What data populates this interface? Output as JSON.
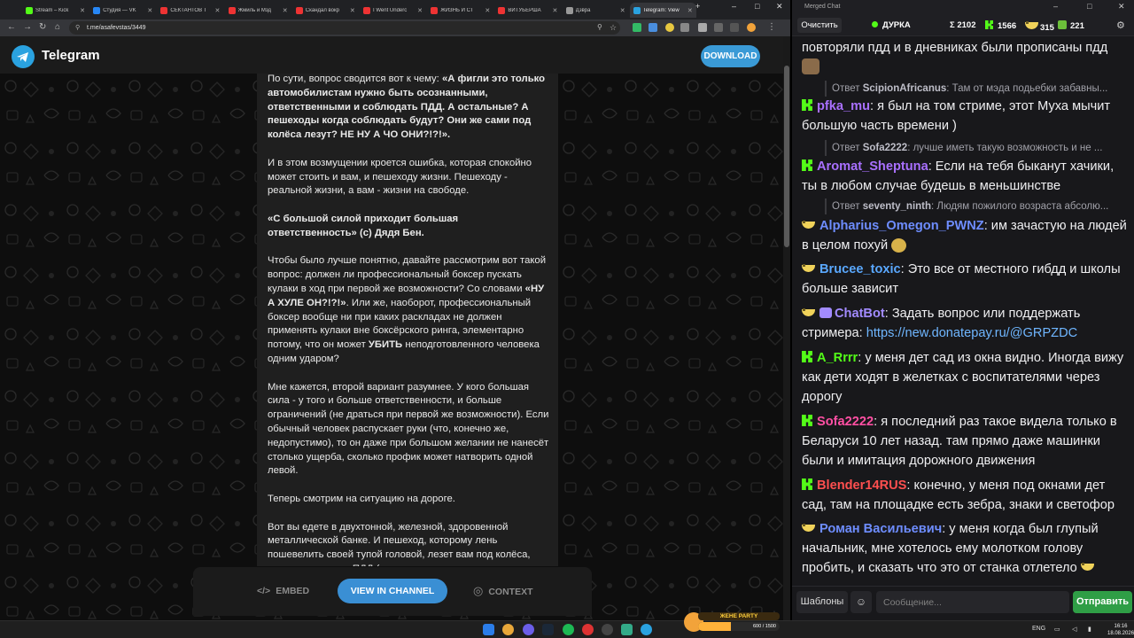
{
  "browser": {
    "tabs": [
      {
        "label": "Stream – Kick",
        "color": "#53fc18",
        "active": false
      },
      {
        "label": "Студия — VK",
        "color": "#2787f5",
        "active": false
      },
      {
        "label": "СЕКТАНТОВ Т",
        "color": "#e33",
        "active": false
      },
      {
        "label": "Жмиль и Мзд",
        "color": "#e33",
        "active": false
      },
      {
        "label": "Скандал вокр",
        "color": "#e33",
        "active": false
      },
      {
        "label": "I Went Underc",
        "color": "#e33",
        "active": false
      },
      {
        "label": "ЖИЗНЬ И СТ",
        "color": "#e33",
        "active": false
      },
      {
        "label": "ВИТУБЕРША",
        "color": "#e33",
        "active": false
      },
      {
        "label": "Дзвра",
        "color": "#999",
        "active": false
      },
      {
        "label": "Telegram: View",
        "color": "#2aa2e0",
        "active": true
      }
    ],
    "new_tab": "+",
    "window_controls": {
      "minimize": "–",
      "maximize": "□",
      "close": "✕"
    },
    "url": "t.me/asafevstas/3449"
  },
  "telegram": {
    "brand": "Telegram",
    "download_label": "DOWNLOAD",
    "post_paragraphs": [
      [
        "По сути, вопрос сводится вот к чему: ",
        {
          "b": "«А фигли это только автомобилистам нужно быть осознанными, ответственными и соблюдать ПДД. А остальные? А пешеходы когда соблюдать будут? Они же сами под колёса лезут? НЕ НУ А ЧО ОНИ?!?!»."
        }
      ],
      [
        "И в этом возмущении кроется ошибка, которая спокойно может стоить и вам, и пешеходу жизни. Пешеходу - реальной жизни, а вам - жизни на свободе."
      ],
      [
        {
          "b": "«С большой силой приходит большая ответственность» (с) Дядя Бен."
        }
      ],
      [
        "Чтобы было лучше понятно, давайте рассмотрим вот такой вопрос: должен ли профессиональный боксер пускать кулаки в ход при первой же возможности? Со словами ",
        {
          "b": "«НУ А ХУЛЕ ОН?!?!»"
        },
        ". Или же, наоборот, профессиональный боксер вообще ни при каких раскладах не должен применять кулаки вне боксёрского ринга, элементарно потому, что он может ",
        {
          "b": "УБИТЬ"
        },
        " неподготовленного человека одним ударом?"
      ],
      [
        "Мне кажется, второй вариант разумнее. У кого большая сила - у того и больше ответственности, и больше ограничений (не драться при первой же возможности). Если обычный человек распускает руки (что, конечно же, недопустимо), то он даже при большом желании не нанесёт столько ущерба, сколько профик может натворить одной левой."
      ],
      [
        "Теперь смотрим на ситуацию на дороге."
      ],
      [
        "Вот вы едете в двухтонной, железной, здоровенной металлической банке. И пешеход, которому лень пошевелить своей тупой головой, лезет вам под колёса, нарушая правила ПДД (которые он, кстати,"
      ]
    ],
    "bottom_bar": {
      "embed_label": "EMBED",
      "view_label": "VIEW IN CHANNEL",
      "context_label": "CONTEXT"
    }
  },
  "chat": {
    "window_title": "Merged Chat",
    "clear_label": "Очистить",
    "status_label": "ДУРКА",
    "stats": {
      "total": "Σ 2102",
      "kick": "1566",
      "banana": "315",
      "other": "221"
    },
    "messages": [
      {
        "text": "повторяли пдд и в дневниках были прописаны пдд"
      },
      {
        "reply_prefix": "Ответ",
        "reply_user": "ScipionAfricanus",
        "reply_text": ": Там от мэда подьебки забавны..."
      },
      {
        "badge": "kick",
        "user": "pfka_mu",
        "color": "#a970ff",
        "text": ": я был на том стриме, этот Муха мычит большую часть времени )"
      },
      {
        "reply_prefix": "Ответ",
        "reply_user": "Sofa2222",
        "reply_text": ": лучше иметь такую возможность и не ..."
      },
      {
        "badge": "kick",
        "user": "Aromat_Sheptuna",
        "color": "#a970ff",
        "text": ": Если на тебя быканут хачики, ты в любом случае будешь в меньшинстве"
      },
      {
        "reply_prefix": "Ответ",
        "reply_user": "seventy_ninth",
        "reply_text": ": Людям пожилого возраста абсолю..."
      },
      {
        "badge": "banana",
        "user": "Alpharius_Omegon_PWNZ",
        "color": "#6e8dff",
        "text": ": им зачастую на людей в целом похуй"
      },
      {
        "badge": "banana",
        "user": "Brucee_toxic",
        "color": "#5aa8ff",
        "text": ": Это все от местного гибдд и школы больше зависит"
      },
      {
        "badge": "banana-bot",
        "user": "ChatBot",
        "color": "#a28bff",
        "text": ": Задать вопрос или поддержать стримера: ",
        "link": "https://new.donatepay.ru/@GRPZDC"
      },
      {
        "badge": "kick",
        "user": "A_Rrrr",
        "color": "#53fc18",
        "text": ": у меня дет сад из окна видно. Иногда вижу как дети ходят в желетках с воспитателями через дорогу"
      },
      {
        "badge": "kick",
        "user": "Sofa2222",
        "color": "#ff4fa3",
        "text": ": я последний раз такое видела только в Беларуси 10 лет назад. там прямо даже машинки были и имитация дорожного движения"
      },
      {
        "badge": "kick",
        "user": "Blender14RUS",
        "color": "#ff4f4f",
        "text": ": конечно, у меня под окнами дет сад, там на площадке есть зебра, знаки и светофор"
      },
      {
        "badge": "banana",
        "user": "Роман Васильевич",
        "color": "#6e8dff",
        "text": ": у меня когда был глупый начальник, мне хотелось ему молотком голову пробить, и сказать что это от станка отлетело"
      }
    ],
    "templates_label": "Шаблоны",
    "input_placeholder": "Сообщение...",
    "send_label": "Отправить"
  },
  "taskbar": {
    "language": "ENG",
    "time": "16:16",
    "date": "18.08.2026",
    "widget_title": "ЖЕНЕ PARTY",
    "widget_progress": "600 / 1500"
  },
  "colors": {
    "accent": "#3a8fd4",
    "kick": "#53fc18",
    "send": "#2f9e46"
  }
}
